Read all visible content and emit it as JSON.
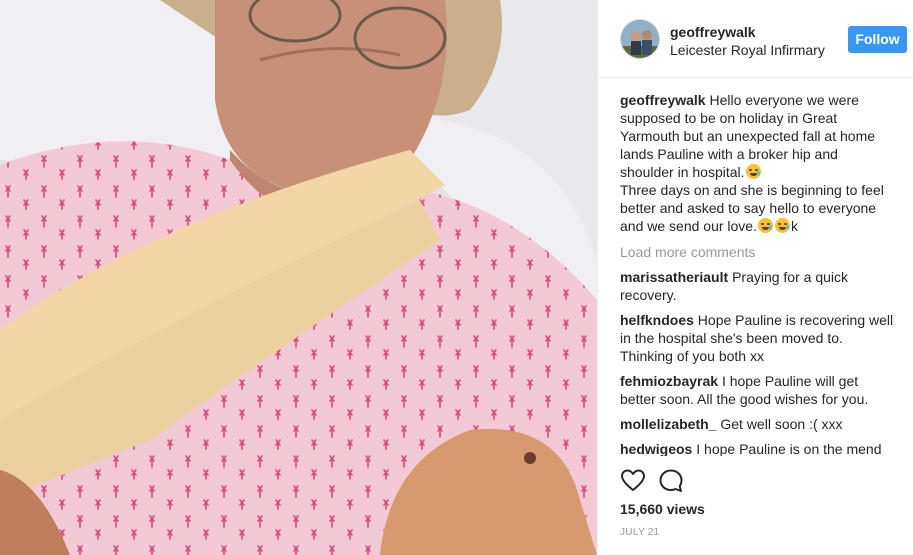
{
  "post": {
    "username": "geoffreywalk",
    "location": "Leicester Royal Infirmary",
    "follow_label": "Follow",
    "caption": {
      "username": "geoffreywalk",
      "line1": "Hello everyone we were",
      "line2": "supposed to be on holiday in Great",
      "line3": "Yarmouth but an unexpected fall at home",
      "line4": "lands Pauline with a broker hip and",
      "line5": "shoulder in hospital.",
      "line6": "Three days on and she is beginning to feel",
      "line7": "better and asked to say hello to everyone",
      "line8": "and we send our love.",
      "line8_tail": "k"
    },
    "load_more_label": "Load more comments",
    "comments": [
      {
        "username": "marissatheriault",
        "lines": [
          "Praying for a quick",
          "recovery."
        ]
      },
      {
        "username": "helfkndoes",
        "lines": [
          "Hope Pauline is recovering well",
          "in the hospital she's been moved to.",
          "Thinking of you both xx"
        ]
      },
      {
        "username": "fehmiozbayrak",
        "lines": [
          "I hope Pauline will get",
          "better soon. All the good wishes for you."
        ]
      },
      {
        "username": "mollelizabeth_",
        "lines": [
          "Get well soon :( xxx"
        ]
      },
      {
        "username": "hedwigeos",
        "lines": [
          "I hope Pauline is on the mend"
        ]
      }
    ],
    "views": "15,660 views",
    "date": "JULY 21",
    "icons": {
      "like": "heart-outline-icon",
      "comment": "speech-bubble-icon",
      "emoji": "sad-face-emoji"
    },
    "colors": {
      "accent": "#3897f0",
      "muted": "#999999",
      "text": "#262626",
      "border": "#efefef"
    }
  }
}
